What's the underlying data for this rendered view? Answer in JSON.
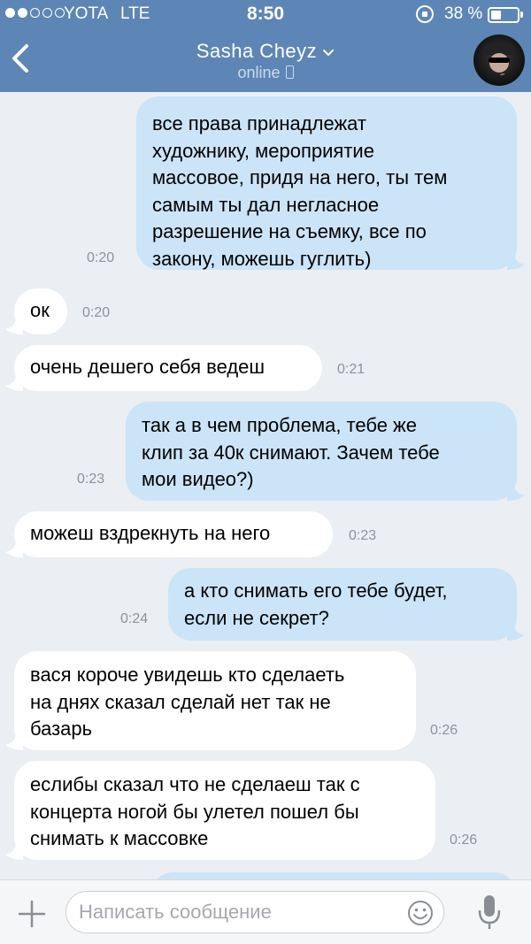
{
  "status_bar": {
    "carrier": "YOTA",
    "network": "LTE",
    "time": "8:50",
    "battery": "38 %",
    "battery_level": 0.38
  },
  "header": {
    "contact_name": "Sasha Cheyz",
    "presence": "online"
  },
  "messages": [
    {
      "dir": "out",
      "lines": [
        "все права принадлежат",
        "художнику, мероприятие",
        "массовое, придя на него, ты тем",
        "самым ты дал негласное",
        "разрешение на съемку, все по",
        "закону, можешь гуглить)"
      ],
      "time": "0:20"
    },
    {
      "dir": "in",
      "lines": [
        "ок"
      ],
      "time": "0:20"
    },
    {
      "dir": "in",
      "lines": [
        "очень дешего себя ведеш"
      ],
      "time": "0:21"
    },
    {
      "dir": "out",
      "lines": [
        "так а в чем проблема, тебе же",
        "клип за 40к снимают. Зачем тебе",
        "мои видео?)"
      ],
      "time": "0:23"
    },
    {
      "dir": "in",
      "lines": [
        "можеш вздрекнуть на него"
      ],
      "time": "0:23"
    },
    {
      "dir": "out",
      "lines": [
        "а кто снимать его тебе будет,",
        "если не секрет?"
      ],
      "time": "0:24"
    },
    {
      "dir": "in",
      "lines": [
        "вася короче увидешь кто сделаеть",
        "на днях сказал сделай нет так не",
        "базарь"
      ],
      "time": "0:26"
    },
    {
      "dir": "in",
      "lines": [
        "еслибы сказал что не сделаеш так с",
        "концерта ногой бы улетел пошел бы",
        "снимать к массовке"
      ],
      "time": "0:26"
    }
  ],
  "input": {
    "placeholder": "Написать сообщение"
  },
  "colors": {
    "header_bg": "#5d86b6",
    "chat_bg": "#ebeef2",
    "outgoing_bubble": "#cce4f7",
    "incoming_bubble": "#ffffff"
  },
  "icons": [
    "back-arrow-icon",
    "chevron-down-icon",
    "phone-icon",
    "plus-icon",
    "smile-icon",
    "microphone-icon",
    "rotation-lock-icon",
    "battery-icon"
  ]
}
